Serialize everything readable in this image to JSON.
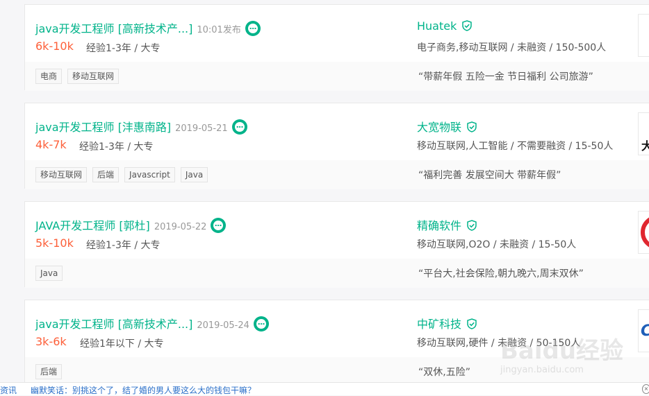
{
  "jobs": [
    {
      "title": "java开发工程师 [高新技术产...]",
      "time": "10:01发布",
      "salary": "6k-10k",
      "req": "经验1-3年 / 大专",
      "company": "Huatek",
      "industry": "电子商务,移动互联网 / 未融资 / 150-500人",
      "tags": [
        "电商",
        "移动互联网"
      ],
      "benefit": "“带薪年假 五险一金 节日福利 公司旅游”"
    },
    {
      "title": "java开发工程师 [沣惠南路]",
      "time": "2019-05-21",
      "salary": "4k-7k",
      "req": "经验1-3年 / 大专",
      "company": "大宽物联",
      "industry": "移动互联网,人工智能 / 不需要融资 / 15-50人",
      "tags": [
        "移动互联网",
        "后端",
        "Javascript",
        "Java"
      ],
      "benefit": "“福利完善 发展空间大 带薪年假”",
      "logo_text": "大"
    },
    {
      "title": "JAVA开发工程师 [郭杜]",
      "time": "2019-05-22",
      "salary": "5k-10k",
      "req": "经验1-3年 / 大专",
      "company": "精确软件",
      "industry": "移动互联网,O2O / 未融资 / 15-50人",
      "tags": [
        "Java"
      ],
      "benefit": "“平台大,社会保险,朝九晚六,周末双休”"
    },
    {
      "title": "java开发工程师 [高新技术产...]",
      "time": "2019-05-24",
      "salary": "3k-6k",
      "req": "经验1年以下 / 大专",
      "company": "中矿科技",
      "industry": "移动互联网,硬件 / 未融资 / 50-150人",
      "tags": [
        "后端"
      ],
      "benefit": "“双休,五险”",
      "logo_text": "C"
    }
  ],
  "footer": {
    "link1": "资讯",
    "link2": "幽默笑话：别挑这个了，结了婚的男人要这么大的钱包干嘛？",
    "close": "×"
  },
  "watermark": {
    "brand": "Baidu经验",
    "url": "jingyan.baidu.com"
  },
  "colors": {
    "accent": "#00b38a",
    "salary": "#fd5f39"
  }
}
